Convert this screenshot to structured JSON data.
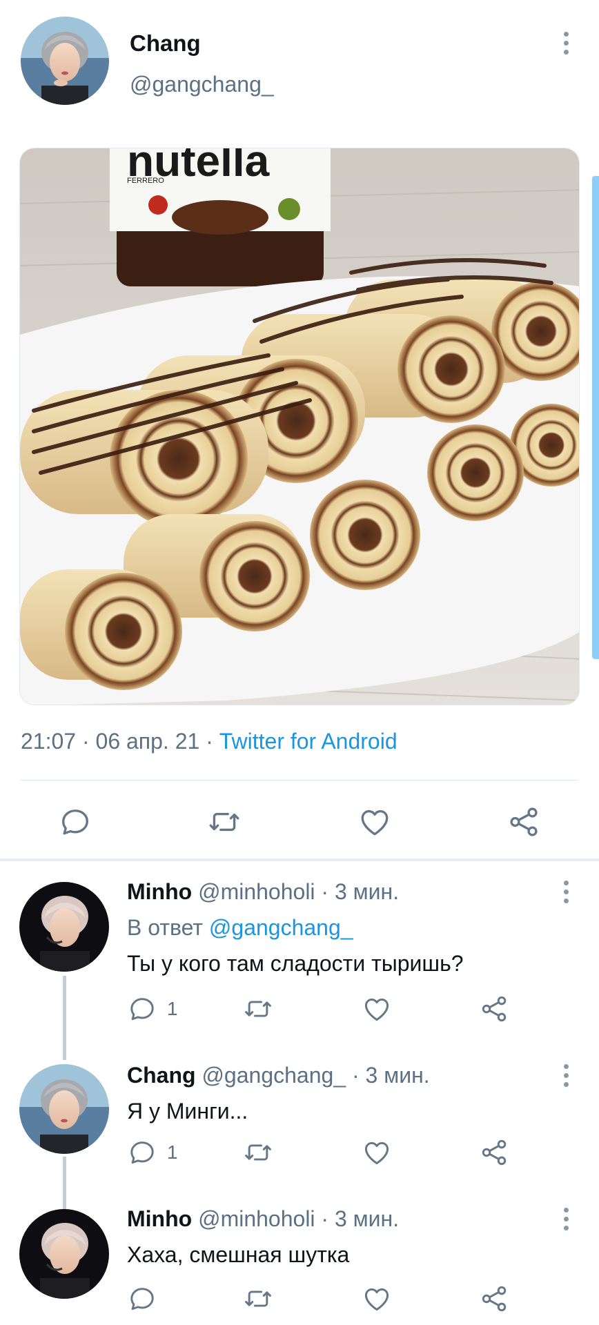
{
  "tweet": {
    "author_name": "Chang",
    "author_handle": "@gangchang_",
    "time": "21:07",
    "date": "06 апр. 21",
    "source": "Twitter for Android",
    "separator": " · ",
    "media_image": "photo of crepe rolls filled with nutella on a white plate, nutella jar in background"
  },
  "replies": [
    {
      "name": "Minho",
      "handle": "@minhoholi",
      "time": "· 3 мин.",
      "reply_to_prefix": "В ответ",
      "reply_to_handle": "@gangchang_",
      "text": "Ты у кого там сладости тыришь?",
      "reply_count": "1"
    },
    {
      "name": "Chang",
      "handle": "@gangchang_",
      "time": "· 3 мин.",
      "text": "Я у Минги...",
      "reply_count": "1"
    },
    {
      "name": "Minho",
      "handle": "@minhoholi",
      "time": "· 3 мин.",
      "text": "Хаха, смешная шутка",
      "reply_count": ""
    }
  ],
  "icons": {
    "reply": "reply-icon",
    "retweet": "retweet-icon",
    "like": "like-icon",
    "share": "share-icon",
    "more": "more-vertical-icon"
  },
  "colors": {
    "accent": "#1b95e0",
    "secondary_text": "#5b7083",
    "icon": "#657786"
  }
}
